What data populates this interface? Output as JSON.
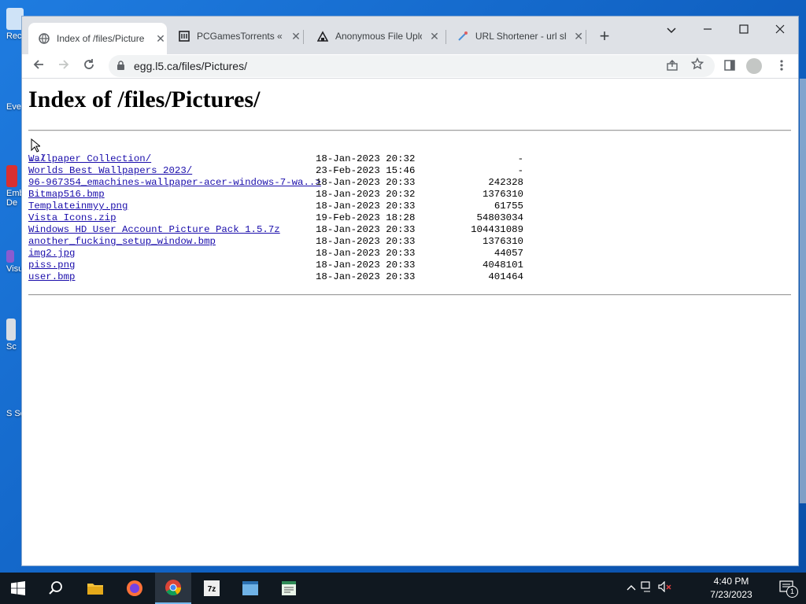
{
  "browser": {
    "tabs": [
      {
        "title": "Index of /files/Picture",
        "favicon": "globe-icon",
        "active": true
      },
      {
        "title": "PCGamesTorrents « T",
        "favicon": "pcgames-icon",
        "active": false
      },
      {
        "title": "Anonymous File Uplo",
        "favicon": "upload-icon",
        "active": false
      },
      {
        "title": "URL Shortener - url sh",
        "favicon": "link-icon",
        "active": false
      }
    ],
    "address": "egg.l5.ca/files/Pictures/"
  },
  "page": {
    "heading": "Index of /files/Pictures/",
    "parent_link": "../",
    "entries": [
      {
        "name": "Wallpaper Collection/",
        "date": "18-Jan-2023 20:32",
        "size": "-"
      },
      {
        "name": "Worlds Best Wallpapers 2023/",
        "date": "23-Feb-2023 15:46",
        "size": "-"
      },
      {
        "name": "96-967354_emachines-wallpaper-acer-windows-7-wa..>",
        "date": "18-Jan-2023 20:33",
        "size": "242328"
      },
      {
        "name": "Bitmap516.bmp",
        "date": "18-Jan-2023 20:32",
        "size": "1376310"
      },
      {
        "name": "Templateinmyy.png",
        "date": "18-Jan-2023 20:33",
        "size": "61755"
      },
      {
        "name": "Vista Icons.zip",
        "date": "19-Feb-2023 18:28",
        "size": "54803034"
      },
      {
        "name": "Windows HD User Account Picture Pack 1.5.7z",
        "date": "18-Jan-2023 20:33",
        "size": "104431089"
      },
      {
        "name": "another_fucking_setup_window.bmp",
        "date": "18-Jan-2023 20:33",
        "size": "1376310"
      },
      {
        "name": "img2.jpg",
        "date": "18-Jan-2023 20:33",
        "size": "44057"
      },
      {
        "name": "piss.png",
        "date": "18-Jan-2023 20:33",
        "size": "4048101"
      },
      {
        "name": "user.bmp",
        "date": "18-Jan-2023 20:33",
        "size": "401464"
      }
    ]
  },
  "desktop": {
    "icon_labels": [
      "Rec",
      "Eve",
      "Emb De",
      "Visu",
      "Sc",
      "S Sc"
    ]
  },
  "taskbar": {
    "time": "4:40 PM",
    "date": "7/23/2023",
    "notification_count": "1"
  }
}
